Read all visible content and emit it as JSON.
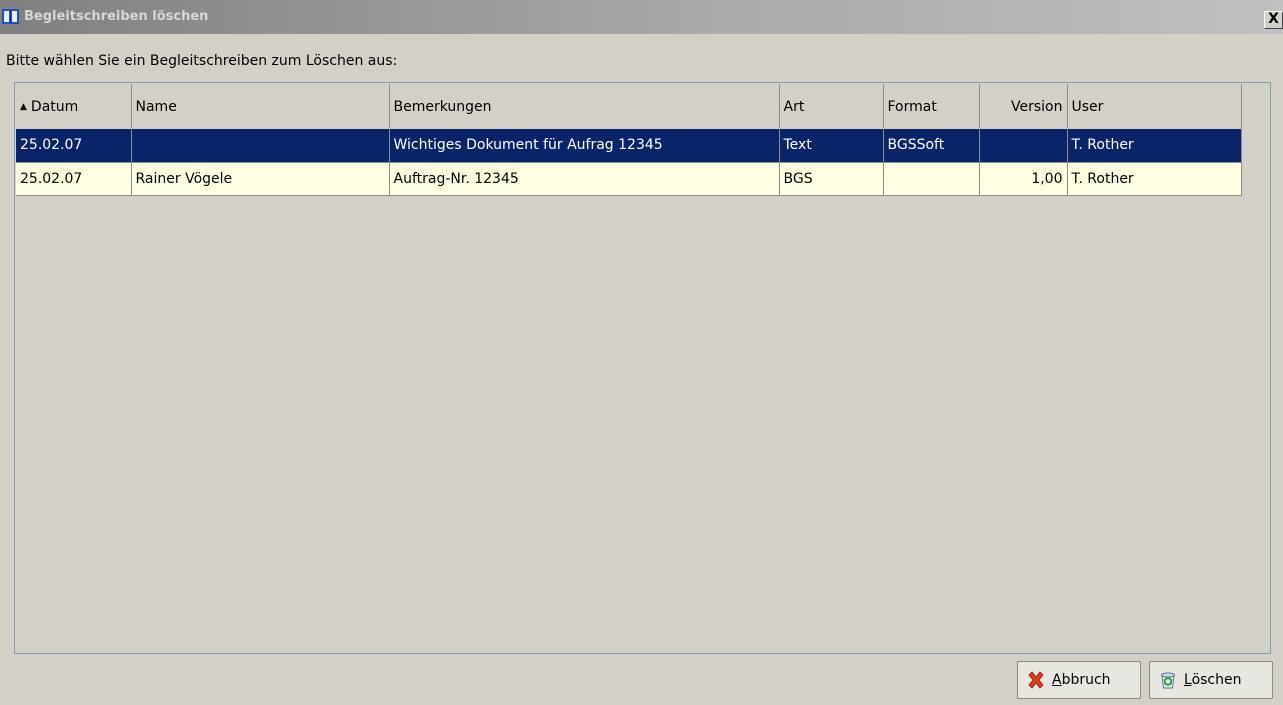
{
  "window": {
    "title": "Begleitschreiben löschen",
    "close_label": "X"
  },
  "prompt": "Bitte wählen Sie ein Begleitschreiben zum Löschen aus:",
  "table": {
    "columns": [
      "Datum",
      "Name",
      "Bemerkungen",
      "Art",
      "Format",
      "Version",
      "User"
    ],
    "sort_column": "Datum",
    "sort_direction": "ascending",
    "rows": [
      [
        "25.02.07",
        "",
        "Wichtiges Dokument für Aufrag 12345",
        "Text",
        "BGSSoft",
        "",
        "T. Rother"
      ],
      [
        "25.02.07",
        "Rainer Vögele",
        "Auftrag-Nr. 12345",
        "BGS",
        "",
        "1,00",
        "T. Rother"
      ]
    ],
    "selected_row": 0
  },
  "buttons": {
    "cancel": {
      "mnemonic": "A",
      "rest": "bbruch",
      "icon": "red-x-icon"
    },
    "delete": {
      "mnemonic": "L",
      "rest": "öschen",
      "icon": "recycle-bin-icon"
    }
  },
  "colors": {
    "selection": "#0a246a",
    "row_background": "#ffffe1",
    "dialog_background": "#d4d0c8"
  }
}
